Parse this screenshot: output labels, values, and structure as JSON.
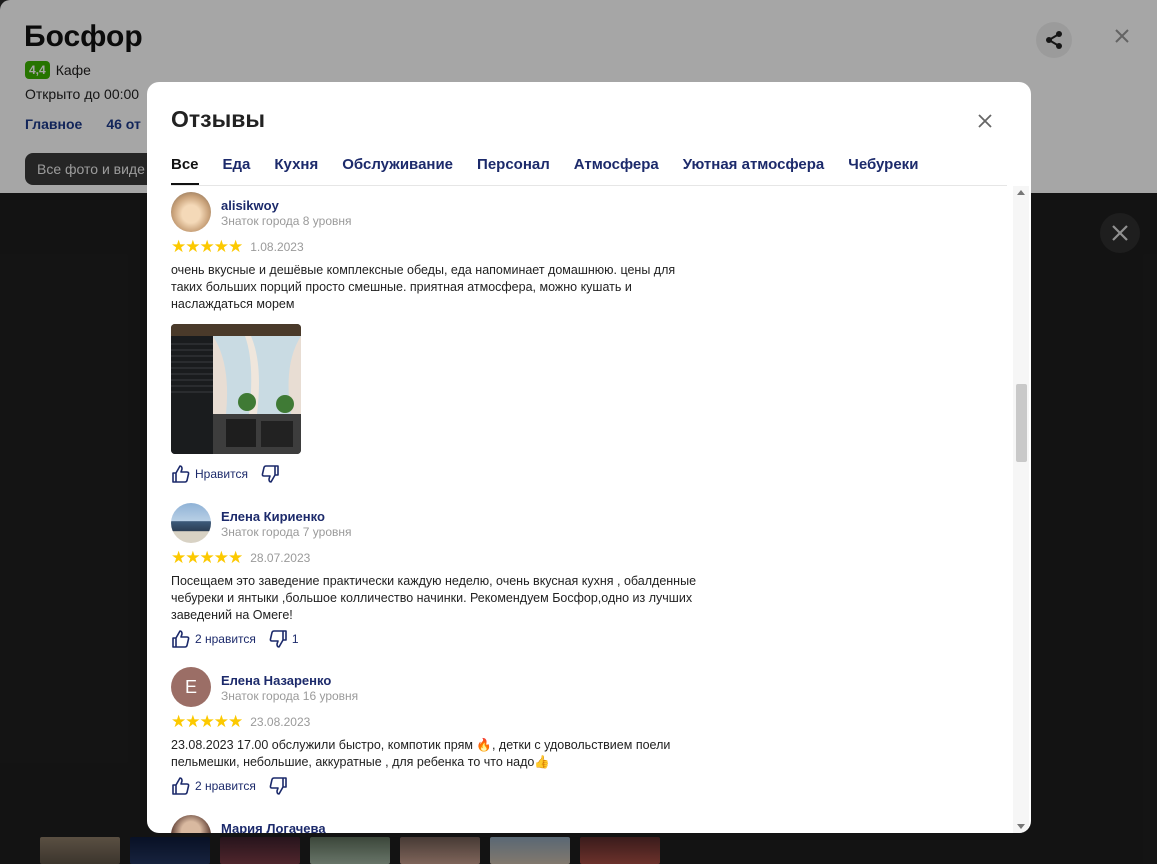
{
  "background": {
    "title": "Босфор",
    "rating": "4,4",
    "category": "Кафе",
    "hours": "Открыто до 00:00",
    "tabs": [
      "Главное",
      "46 от"
    ],
    "photo_button": "Все фото и виде"
  },
  "modal": {
    "title": "Отзывы",
    "tabs": [
      "Все",
      "Еда",
      "Кухня",
      "Обслуживание",
      "Персонал",
      "Атмосфера",
      "Уютная атмосфера",
      "Чебуреки"
    ],
    "active_tab": "Все"
  },
  "reviews": [
    {
      "author": "alisikwoy",
      "level": "Знаток города 8 уровня",
      "stars": 5,
      "date": "1.08.2023",
      "text": "очень вкусные и дешёвые комплексные обеды, еда напоминает домашнюю. цены для таких больших порций просто смешные. приятная атмосфера, можно кушать и наслаждаться морем",
      "like_label": "Нравится",
      "dislike_count": ""
    },
    {
      "author": "Елена Кириенко",
      "level": "Знаток города 7 уровня",
      "stars": 5,
      "date": "28.07.2023",
      "text": "Посещаем это заведение практически каждую неделю, очень вкусная кухня , обалденные чебуреки и янтыки ,большое колличество начинки. Рекомендуем Босфор,одно из лучших заведений на Омеге!",
      "like_label": "2 нравится",
      "dislike_count": "1"
    },
    {
      "author": "Елена Назаренко",
      "avatar_letter": "Е",
      "level": "Знаток города 16 уровня",
      "stars": 5,
      "date": "23.08.2023",
      "text": "23.08.2023 17.00 обслужили быстро, компотик прям 🔥, детки с удовольствием поели пельмешки, небольшие, аккуратные , для ребенка то что надо👍",
      "like_label": "2 нравится",
      "dislike_count": ""
    },
    {
      "author": "Мария Логачева"
    }
  ],
  "colors": {
    "accent": "#1c2a6b",
    "star": "#fcc900",
    "rating_badge": "#3bb300",
    "avatar_letter_bg": "#9b6e66"
  },
  "icons": [
    "share-icon",
    "close-icon",
    "like-icon",
    "dislike-icon"
  ]
}
